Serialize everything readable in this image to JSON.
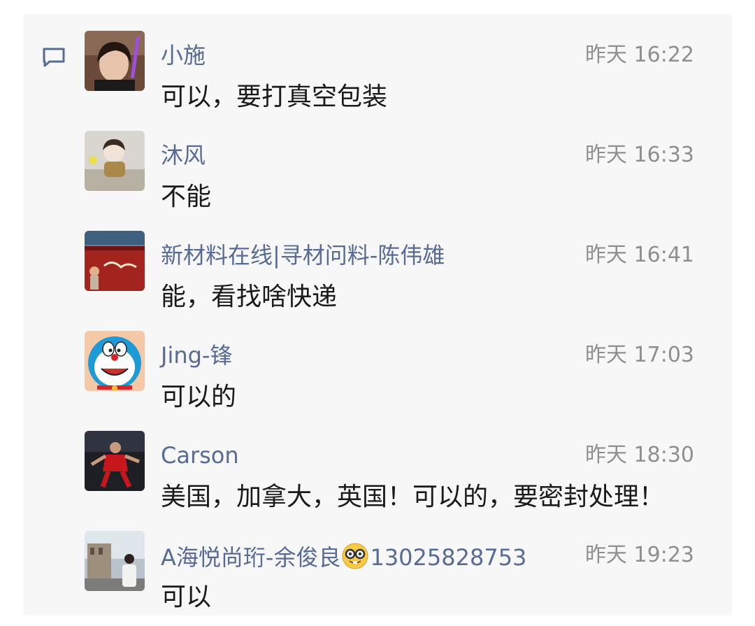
{
  "comments": [
    {
      "name": "小施",
      "time": "昨天 16:22",
      "text": "可以，要打真空包装"
    },
    {
      "name": "沐风",
      "time": "昨天 16:33",
      "text": "不能"
    },
    {
      "name": "新材料在线|寻材问料-陈伟雄",
      "time": "昨天 16:41",
      "text": "能，看找啥快递"
    },
    {
      "name": "Jing-锋",
      "time": "昨天 17:03",
      "text": "可以的"
    },
    {
      "name": "Carson",
      "time": "昨天 18:30",
      "text": "美国，加拿大，英国！可以的，要密封处理！"
    },
    {
      "name_prefix": "A海悦尚珩-余俊良",
      "name_suffix": "13025828753",
      "name_emoji": "nerd-face-emoji",
      "time": "昨天 19:23",
      "text": "可以"
    }
  ],
  "icons": {
    "comment": "comment-bubble-icon"
  },
  "colors": {
    "name": "#576b95",
    "time": "#8f8f8f",
    "text": "#1a1a1a",
    "panel": "#f7f7f7",
    "icon": "#576b95"
  }
}
